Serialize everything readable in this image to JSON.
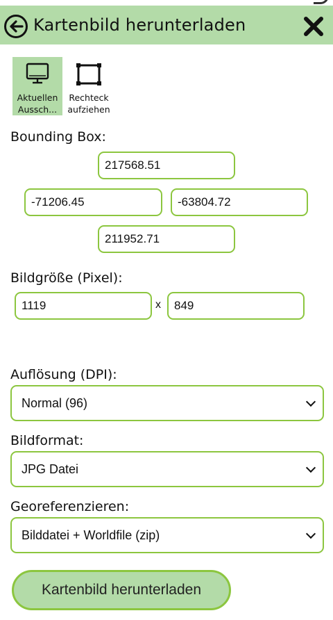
{
  "header": {
    "title": "Kartenbild herunterladen"
  },
  "tools": [
    {
      "label_line1": "Aktuellen",
      "label_line2": "Aussch...",
      "icon": "monitor-icon"
    },
    {
      "label_line1": "Rechteck",
      "label_line2": "aufziehen",
      "icon": "rectangle-icon"
    }
  ],
  "bbox": {
    "label": "Bounding Box:",
    "top": "217568.51",
    "left": "-71206.45",
    "right": "-63804.72",
    "bottom": "211952.71"
  },
  "image_size": {
    "label": "Bildgröße (Pixel):",
    "width": "1119",
    "separator": "x",
    "height": "849"
  },
  "resolution": {
    "label": "Auflösung (DPI):",
    "value": "Normal (96)"
  },
  "format": {
    "label": "Bildformat:",
    "value": "JPG Datei"
  },
  "georef": {
    "label": "Georeferenzieren:",
    "value": "Bilddatei + Worldfile (zip)"
  },
  "download_button": "Kartenbild herunterladen",
  "colors": {
    "header_bg": "#b3dba8",
    "accent_border": "#8cc63f"
  }
}
